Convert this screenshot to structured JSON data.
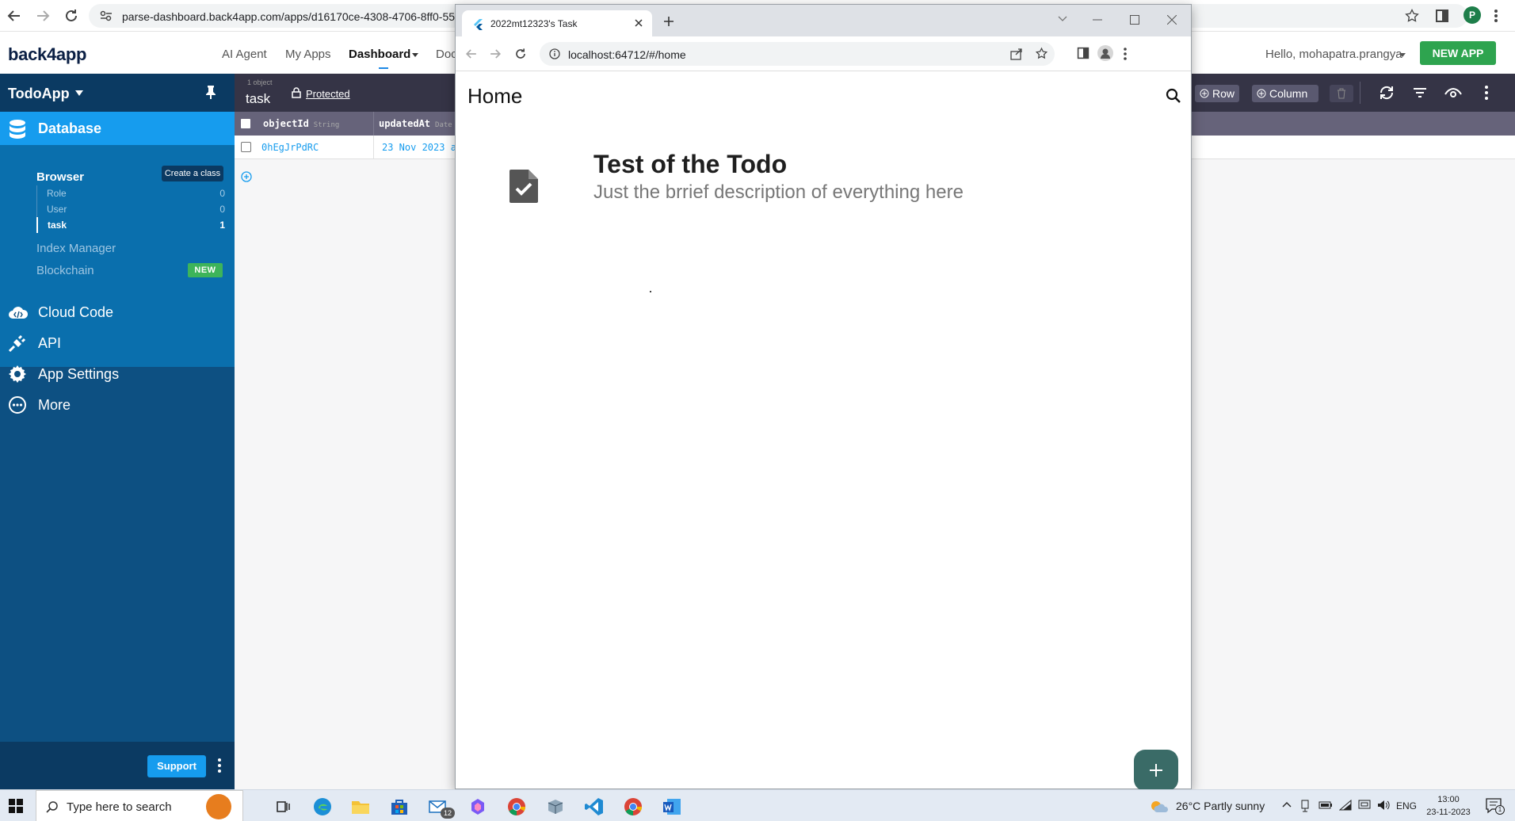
{
  "back_browser": {
    "url": "parse-dashboard.back4app.com/apps/d16170ce-4308-4706-8ff0-55",
    "avatar_letter": "P"
  },
  "topnav": {
    "logo": "back4app",
    "links": [
      "AI Agent",
      "My Apps",
      "Dashboard",
      "Doc"
    ],
    "greeting": "Hello, mohapatra.prangya",
    "new_app": "NEW APP"
  },
  "sidebar": {
    "app_name": "TodoApp",
    "database": "Database",
    "browser": "Browser",
    "create_class": "Create a class",
    "classes": [
      {
        "name": "Role",
        "count": "0"
      },
      {
        "name": "User",
        "count": "0"
      },
      {
        "name": "task",
        "count": "1"
      }
    ],
    "index_manager": "Index Manager",
    "blockchain": "Blockchain",
    "new_badge": "NEW",
    "cloud_code": "Cloud Code",
    "api": "API",
    "app_settings": "App Settings",
    "more": "More",
    "support": "Support"
  },
  "data_browser": {
    "object_count": "1 object",
    "class_name": "task",
    "protected": "Protected",
    "row_button": "Row",
    "column_button": "Column",
    "columns": [
      {
        "name": "objectId",
        "type": "String"
      },
      {
        "name": "updatedAt",
        "type": "Date"
      }
    ],
    "rows": [
      {
        "objectId": "0hEgJrPdRC",
        "updatedAt": "23 Nov 2023 a"
      }
    ]
  },
  "front_window": {
    "tab_title": "2022mt12323's Task",
    "url": "localhost:64712/#/home",
    "app_bar_title": "Home",
    "todo": {
      "title": "Test of the Todo",
      "description": "Just the brrief description of everything here"
    }
  },
  "taskbar": {
    "search_placeholder": "Type here to search",
    "mail_badge": "12",
    "weather": "26°C  Partly sunny",
    "language": "ENG",
    "time": "13:00",
    "date": "23-11-2023",
    "notification_count": "1"
  }
}
